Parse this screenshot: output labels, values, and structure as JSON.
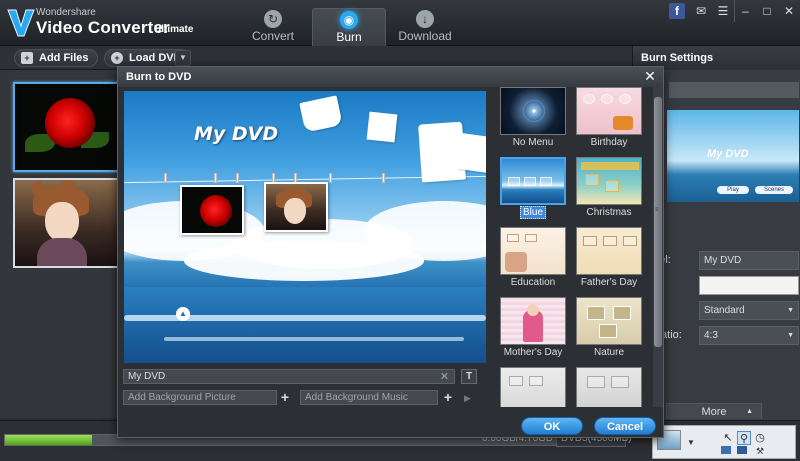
{
  "app": {
    "brand_small": "Wondershare",
    "brand_big": "Video Converter",
    "brand_edition": "Ultimate",
    "logo_letter": "V"
  },
  "tabs": [
    {
      "label": "Convert",
      "icon": "refresh-icon"
    },
    {
      "label": "Burn",
      "icon": "disc-icon"
    },
    {
      "label": "Download",
      "icon": "download-icon"
    }
  ],
  "window_controls": [
    "f",
    "chat",
    "menu",
    "minimize",
    "maximize",
    "close"
  ],
  "toolbar": {
    "add_files": "Add Files",
    "load_dvd": "Load DVD"
  },
  "settings": {
    "title": "Burn Settings",
    "preview_title": "My DVD",
    "preview_play": "Play",
    "preview_scenes": "Scenes",
    "label_label": "abel:",
    "label_value": "My DVD",
    "menu_label": "p:",
    "menu_value": "",
    "video_label": "v:",
    "video_value": "Standard",
    "ratio_label": ": Ratio:",
    "ratio_value": "4:3",
    "more": "More"
  },
  "bottom": {
    "progress_fraction": 0.14,
    "size_text": "0.00GB/4.70GB",
    "disc_type": "DVD5(4500MB)"
  },
  "dialog": {
    "title": "Burn to DVD",
    "dvd_title": "My DVD",
    "title_field": "My DVD",
    "bg_picture_placeholder": "Add Background Picture",
    "bg_music_placeholder": "Add Background Music",
    "ok": "OK",
    "cancel": "Cancel",
    "templates": [
      {
        "label": "No Menu",
        "selected": false
      },
      {
        "label": "Birthday",
        "selected": false
      },
      {
        "label": "Blue",
        "selected": true
      },
      {
        "label": "Christmas",
        "selected": false
      },
      {
        "label": "Education",
        "selected": false
      },
      {
        "label": "Father's Day",
        "selected": false
      },
      {
        "label": "Mother's Day",
        "selected": false
      },
      {
        "label": "Nature",
        "selected": false
      },
      {
        "label": "",
        "selected": false
      },
      {
        "label": "",
        "selected": false
      }
    ]
  },
  "colors": {
    "accent": "#2aa8f2",
    "ok_button": "#1f7dd4",
    "progress": "#6cc12a"
  }
}
